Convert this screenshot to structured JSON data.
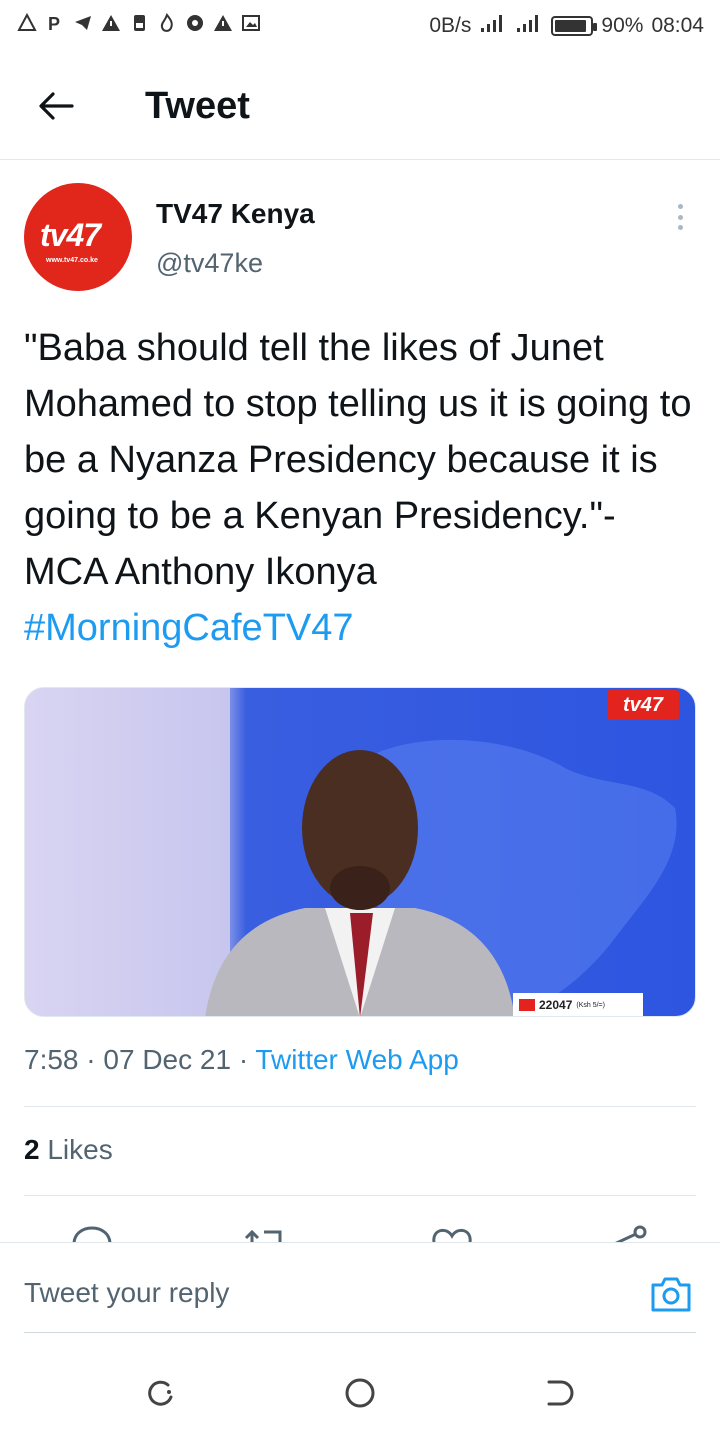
{
  "status_bar": {
    "network_speed": "0B/s",
    "battery_percent": "90%",
    "battery_level": 0.9,
    "time": "08:04",
    "notification_icons": [
      "alert-icon",
      "p-icon",
      "telegram-icon",
      "warning-icon",
      "sim-icon",
      "fire-icon",
      "chrome-icon",
      "warning-icon",
      "image-icon"
    ]
  },
  "header": {
    "title": "Tweet"
  },
  "tweet": {
    "author_name": "TV47 Kenya",
    "author_handle": "@tv47ke",
    "avatar_logo": "tv47",
    "avatar_url": "www.tv47.co.ke",
    "text": "\"Baba should tell the likes of Junet Mohamed to stop telling us it is going to be a Nyanza Presidency because it is going to be a Kenyan Presidency.\"- MCA Anthony Ikonya",
    "hashtag": "#MorningCafeTV47",
    "media": {
      "badge": "tv47",
      "ticker_number": "22047",
      "ticker_price": "(Ksh 5/=)"
    },
    "time": "7:58",
    "date": "07 Dec 21",
    "separator": "·",
    "source": "Twitter Web App",
    "likes_count": "2",
    "likes_label": "Likes"
  },
  "reply": {
    "placeholder": "Tweet your reply"
  },
  "colors": {
    "accent": "#1d9bf0",
    "brand_red": "#e1261c",
    "text_primary": "#0f1419",
    "text_secondary": "#536471"
  }
}
